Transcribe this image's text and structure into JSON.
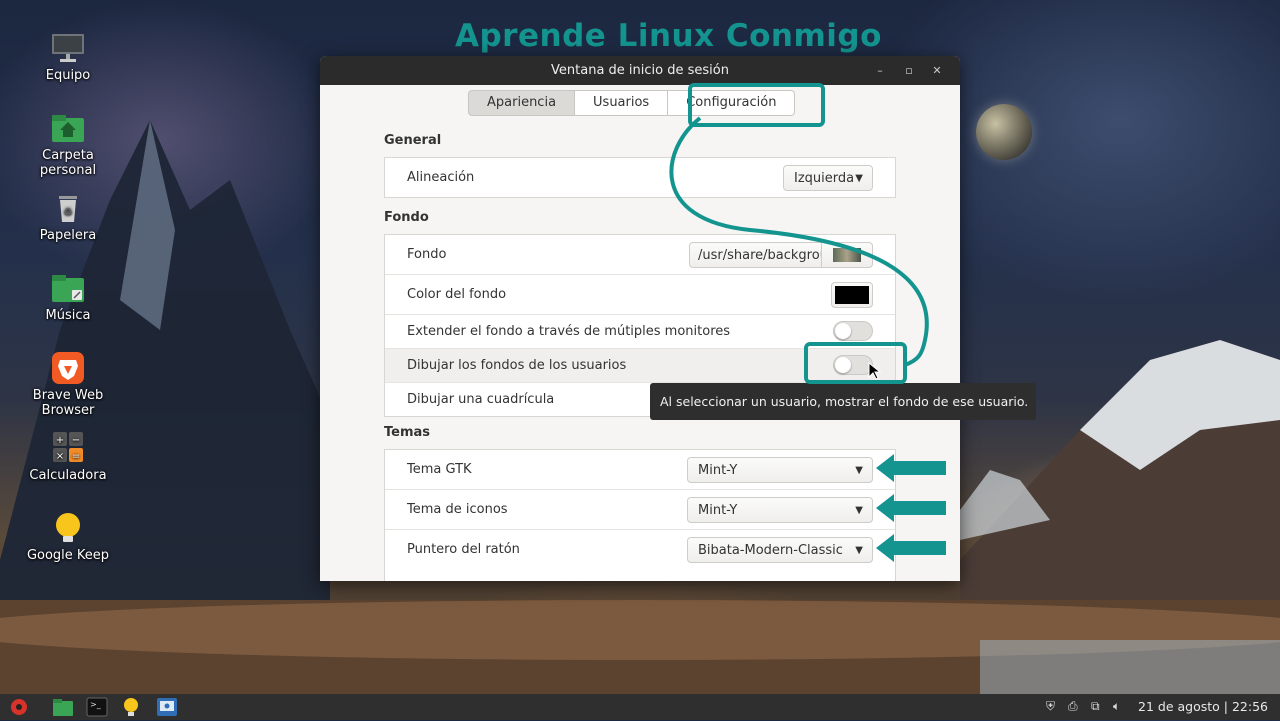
{
  "banner": "Aprende Linux Conmigo",
  "desktop_icons": [
    {
      "label": "Equipo",
      "icon": "computer-icon"
    },
    {
      "label": "Carpeta personal",
      "icon": "home-folder-icon"
    },
    {
      "label": "Papelera",
      "icon": "trash-icon"
    },
    {
      "label": "Música",
      "icon": "music-folder-icon"
    },
    {
      "label": "Brave Web Browser",
      "icon": "brave-icon"
    },
    {
      "label": "Calculadora",
      "icon": "calculator-icon"
    },
    {
      "label": "Google Keep",
      "icon": "keep-icon"
    }
  ],
  "window": {
    "title": "Ventana de inicio de sesión",
    "tabs": [
      "Apariencia",
      "Usuarios",
      "Configuración"
    ],
    "active_tab": "Apariencia",
    "general": {
      "title": "General",
      "alignment_label": "Alineación",
      "alignment_value": "Izquierda"
    },
    "fondo": {
      "title": "Fondo",
      "background_label": "Fondo",
      "background_value": "/usr/share/backgrou",
      "color_label": "Color del fondo",
      "color_value": "#000000",
      "extend_label": "Extender el fondo a través de mútiples monitores",
      "extend_on": false,
      "draw_user_bg_label": "Dibujar los fondos de los usuarios",
      "draw_user_bg_on": false,
      "grid_label": "Dibujar una cuadrícula"
    },
    "temas": {
      "title": "Temas",
      "gtk_label": "Tema GTK",
      "gtk_value": "Mint-Y",
      "icons_label": "Tema de iconos",
      "icons_value": "Mint-Y",
      "cursor_label": "Puntero del ratón",
      "cursor_value": "Bibata-Modern-Classic"
    }
  },
  "tooltip": "Al seleccionar un usuario, mostrar el fondo de ese usuario.",
  "accent_color": "#14948f",
  "taskbar": {
    "clock": "21 de agosto | 22:56"
  }
}
